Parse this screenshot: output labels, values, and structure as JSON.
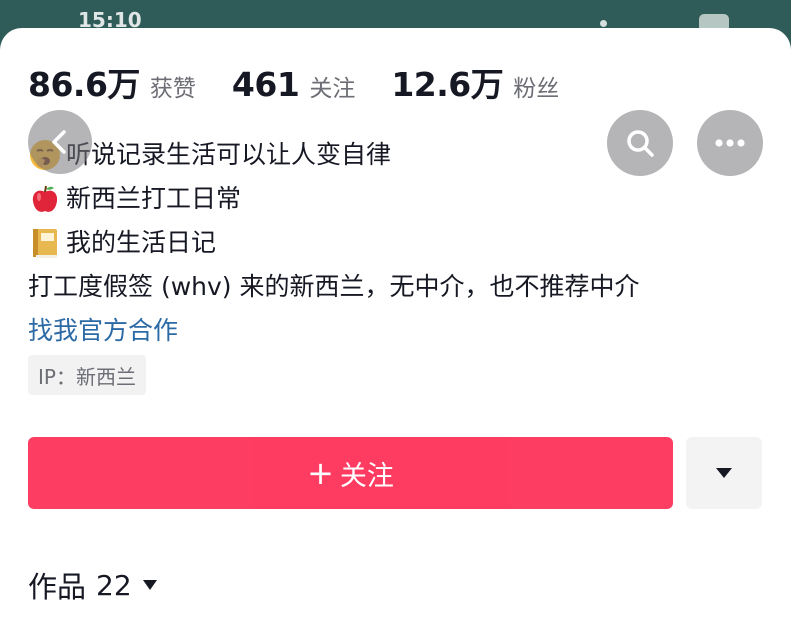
{
  "status_bar": {
    "time": "15:10"
  },
  "stats": [
    {
      "num": "86.6万",
      "label": "获赞"
    },
    {
      "num": "461",
      "label": "关注"
    },
    {
      "num": "12.6万",
      "label": "粉丝"
    }
  ],
  "header": {
    "back_icon": "chevron-left-icon",
    "search_icon": "search-icon",
    "more_icon": "ellipsis-icon"
  },
  "bio": {
    "line1": "听说记录生活可以让人变自律",
    "line2": "新西兰打工日常",
    "line3": "我的生活日记",
    "line4": "打工度假签 (whv) 来的新西兰，无中介，也不推荐中介",
    "link": "找我官方合作",
    "emojis": [
      "yawning-face-emoji",
      "red-apple-emoji",
      "notebook-emoji"
    ]
  },
  "ip": "IP：新西兰",
  "follow": {
    "plus": "+",
    "label": "关注"
  },
  "works": {
    "label": "作品",
    "count": "22"
  },
  "colors": {
    "accent": "#fe2c55",
    "link": "#2c6aa6",
    "text": "#161823",
    "muted": "#6d6e75"
  }
}
